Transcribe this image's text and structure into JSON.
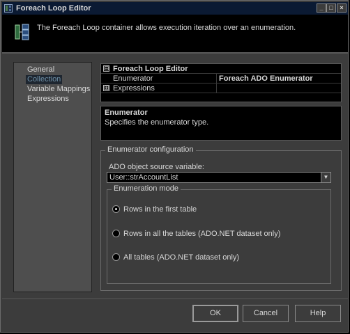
{
  "window": {
    "title": "Foreach Loop Editor",
    "minimize_symbol": "_",
    "maximize_symbol": "□",
    "close_symbol": "×"
  },
  "header": {
    "text": "The Foreach Loop container allows execution iteration over an enumeration.",
    "icon": "foreach-loop-icon"
  },
  "nav": {
    "items": [
      {
        "label": "General",
        "selected": false
      },
      {
        "label": "Collection",
        "selected": true
      },
      {
        "label": "Variable Mappings",
        "selected": false
      },
      {
        "label": "Expressions",
        "selected": false
      }
    ]
  },
  "property_grid": {
    "category": "Foreach Loop Editor",
    "category_expander": "⊟",
    "rows": [
      {
        "name": "Enumerator",
        "value": "Foreach ADO Enumerator"
      },
      {
        "name": "Expressions",
        "value": "",
        "expander": "⊞"
      }
    ]
  },
  "description": {
    "title": "Enumerator",
    "text": "Specifies the enumerator type."
  },
  "enumerator_config": {
    "legend": "Enumerator configuration",
    "source_label": "ADO object source variable:",
    "source_value": "User::strAccountList",
    "mode": {
      "legend": "Enumeration mode",
      "options": [
        {
          "label": "Rows in the first table",
          "selected": true
        },
        {
          "label": "Rows in all the tables (ADO.NET dataset only)",
          "selected": false
        },
        {
          "label": "All tables (ADO.NET dataset only)",
          "selected": false
        }
      ]
    }
  },
  "buttons": {
    "ok": "OK",
    "cancel": "Cancel",
    "help": "Help"
  },
  "colors": {
    "background": "#3c3c3c",
    "titlebar": "#0b1a33",
    "selected_text": "#6e8fa6"
  }
}
